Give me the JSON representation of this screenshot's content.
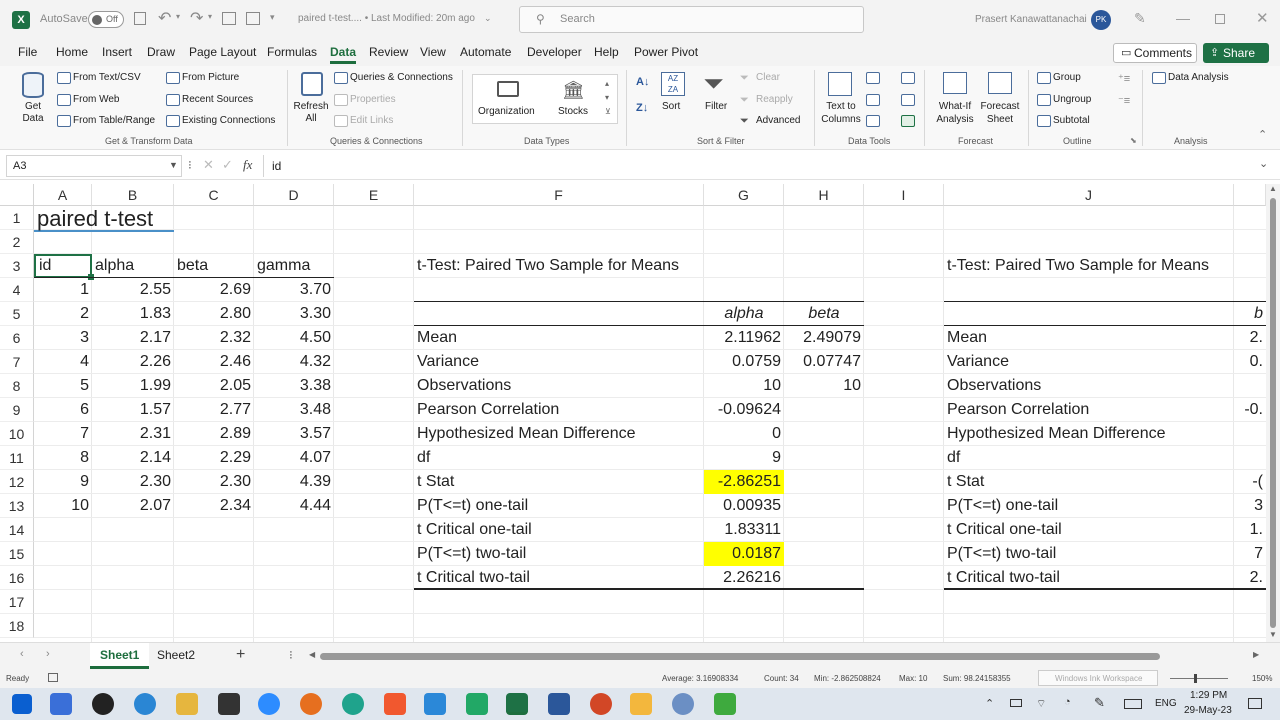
{
  "titlebar": {
    "app_icon": "X",
    "autosave_label": "AutoSave",
    "autosave_state": "Off",
    "doc_title": "paired t-test.... • Last Modified: 20m ago",
    "search_placeholder": "Search",
    "user_name": "Prasert Kanawattanachai",
    "user_initials": "PK"
  },
  "menu": {
    "items": [
      "File",
      "Home",
      "Insert",
      "Draw",
      "Page Layout",
      "Formulas",
      "Data",
      "Review",
      "View",
      "Automate",
      "Developer",
      "Help",
      "Power Pivot"
    ],
    "active": "Data",
    "comments_label": "Comments",
    "share_label": "Share"
  },
  "ribbon": {
    "get_data": "Get Data",
    "from_text_csv": "From Text/CSV",
    "from_web": "From Web",
    "from_table_range": "From Table/Range",
    "from_picture": "From Picture",
    "recent_sources": "Recent Sources",
    "existing_connections": "Existing Connections",
    "group_get_transform": "Get & Transform Data",
    "refresh_all": "Refresh All",
    "queries_connections": "Queries & Connections",
    "properties": "Properties",
    "edit_links": "Edit Links",
    "group_queries": "Queries & Connections",
    "organization": "Organization",
    "stocks": "Stocks",
    "group_data_types": "Data Types",
    "sort": "Sort",
    "filter": "Filter",
    "clear": "Clear",
    "reapply": "Reapply",
    "advanced": "Advanced",
    "group_sort_filter": "Sort & Filter",
    "text_to_columns": "Text to Columns",
    "group_data_tools": "Data Tools",
    "what_if": "What-If Analysis",
    "forecast_sheet": "Forecast Sheet",
    "group_forecast": "Forecast",
    "group_btn": "Group",
    "ungroup_btn": "Ungroup",
    "subtotal_btn": "Subtotal",
    "group_outline": "Outline",
    "data_analysis": "Data Analysis",
    "group_analysis": "Analysis"
  },
  "formula_bar": {
    "name_box": "A3",
    "fx": "fx",
    "content": "id"
  },
  "columns": [
    "A",
    "B",
    "C",
    "D",
    "E",
    "F",
    "G",
    "H",
    "I",
    "J"
  ],
  "rows": [
    "1",
    "2",
    "3",
    "4",
    "5",
    "6",
    "7",
    "8",
    "9",
    "10",
    "11",
    "12",
    "13",
    "14",
    "15",
    "16",
    "17",
    "18"
  ],
  "sheet": {
    "title": "paired t-test",
    "headers": [
      "id",
      "alpha",
      "beta",
      "gamma"
    ],
    "data": [
      [
        "1",
        "2.55",
        "2.69",
        "3.70"
      ],
      [
        "2",
        "1.83",
        "2.80",
        "3.30"
      ],
      [
        "3",
        "2.17",
        "2.32",
        "4.50"
      ],
      [
        "4",
        "2.26",
        "2.46",
        "4.32"
      ],
      [
        "5",
        "1.99",
        "2.05",
        "3.38"
      ],
      [
        "6",
        "1.57",
        "2.77",
        "3.48"
      ],
      [
        "7",
        "2.31",
        "2.89",
        "3.57"
      ],
      [
        "8",
        "2.14",
        "2.29",
        "4.07"
      ],
      [
        "9",
        "2.30",
        "2.30",
        "4.39"
      ],
      [
        "10",
        "2.07",
        "2.34",
        "4.44"
      ]
    ]
  },
  "ttest1": {
    "title": "t-Test: Paired Two Sample for Means",
    "col1": "alpha",
    "col2": "beta",
    "rows": [
      {
        "label": "Mean",
        "v1": "2.11962",
        "v2": "2.49079"
      },
      {
        "label": "Variance",
        "v1": "0.0759",
        "v2": "0.07747"
      },
      {
        "label": "Observations",
        "v1": "10",
        "v2": "10"
      },
      {
        "label": "Pearson Correlation",
        "v1": "-0.09624",
        "v2": ""
      },
      {
        "label": "Hypothesized Mean Difference",
        "v1": "0",
        "v2": ""
      },
      {
        "label": "df",
        "v1": "9",
        "v2": ""
      },
      {
        "label": "t Stat",
        "v1": "-2.86251",
        "v2": ""
      },
      {
        "label": "P(T<=t) one-tail",
        "v1": "0.00935",
        "v2": ""
      },
      {
        "label": "t Critical one-tail",
        "v1": "1.83311",
        "v2": ""
      },
      {
        "label": "P(T<=t) two-tail",
        "v1": "0.0187",
        "v2": ""
      },
      {
        "label": "t Critical two-tail",
        "v1": "2.26216",
        "v2": ""
      }
    ],
    "highlight_color": "#ffff00"
  },
  "ttest2": {
    "title": "t-Test: Paired Two Sample for Means",
    "col1_partial": "b",
    "labels": [
      "Mean",
      "Variance",
      "Observations",
      "Pearson Correlation",
      "Hypothesized Mean Difference",
      "df",
      "t Stat",
      "P(T<=t) one-tail",
      "t Critical one-tail",
      "P(T<=t) two-tail",
      "t Critical two-tail"
    ],
    "partials": [
      "2.",
      "0.",
      "",
      "-0.",
      "",
      "",
      "-(",
      "3",
      "1.",
      "7",
      "2."
    ]
  },
  "tabs": {
    "items": [
      "Sheet1",
      "Sheet2"
    ],
    "active": "Sheet1",
    "add": "+"
  },
  "status": {
    "ready": "Ready",
    "average": "Average: 3.16908334",
    "count": "Count: 34",
    "min": "Min: -2.862508824",
    "max": "Max: 10",
    "sum": "Sum: 98.24158355",
    "overlay": "Windows Ink Workspace",
    "zoom": "150%"
  },
  "taskbar": {
    "lang": "ENG",
    "time": "1:29 PM",
    "date": "29-May-23"
  },
  "colors": {
    "accent": "#1e6e3e",
    "highlight": "#ffff00",
    "avatar": "#2b579a"
  }
}
